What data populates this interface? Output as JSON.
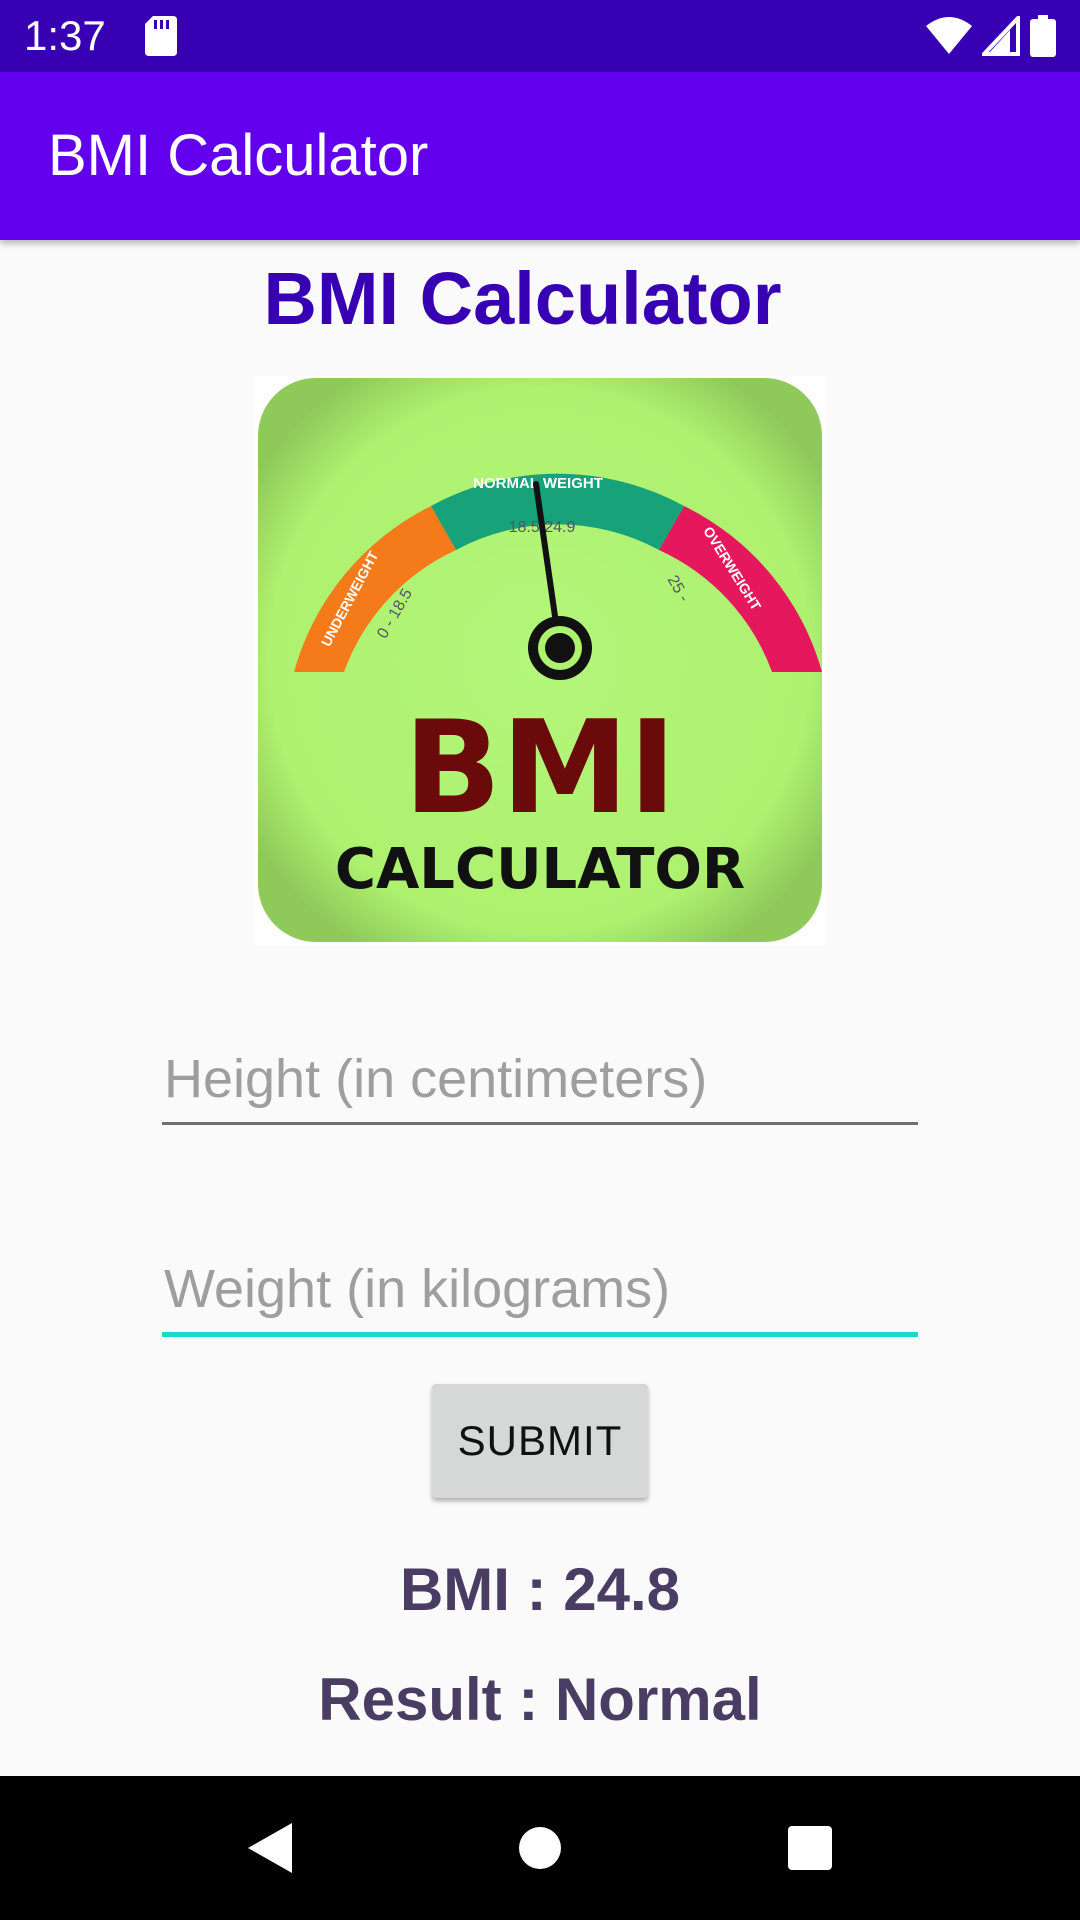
{
  "status_bar": {
    "time": "1:37",
    "icons": [
      "sd-card-icon",
      "wifi-icon",
      "signal-icon",
      "battery-icon"
    ]
  },
  "app_bar": {
    "title": "BMI Calculator",
    "color": "#6200ee"
  },
  "main": {
    "heading": "BMI Calculator",
    "logo": {
      "label_normal": "NORMAL WEIGHT",
      "label_underweight": "UNDERWEIGHT",
      "label_overweight": "OVERWEIGHT",
      "range_underweight": "0 - 18.5",
      "range_normal": "18.5  24.9",
      "range_overweight": "25 -",
      "brand_big": "BMI",
      "brand_small": "CALCULATOR"
    },
    "height_input": {
      "placeholder": "Height (in centimeters)",
      "value": ""
    },
    "weight_input": {
      "placeholder": "Weight (in kilograms)",
      "value": ""
    },
    "submit_label": "SUBMIT",
    "bmi_text": "BMI : 24.8",
    "result_text": "Result : Normal"
  },
  "colors": {
    "status_bar": "#3700b3",
    "heading": "#3700b3",
    "focused_underline": "#1ed6c9",
    "result_text": "#493d63"
  },
  "nav_bar": {
    "buttons": [
      "back-icon",
      "home-icon",
      "recents-icon"
    ]
  }
}
